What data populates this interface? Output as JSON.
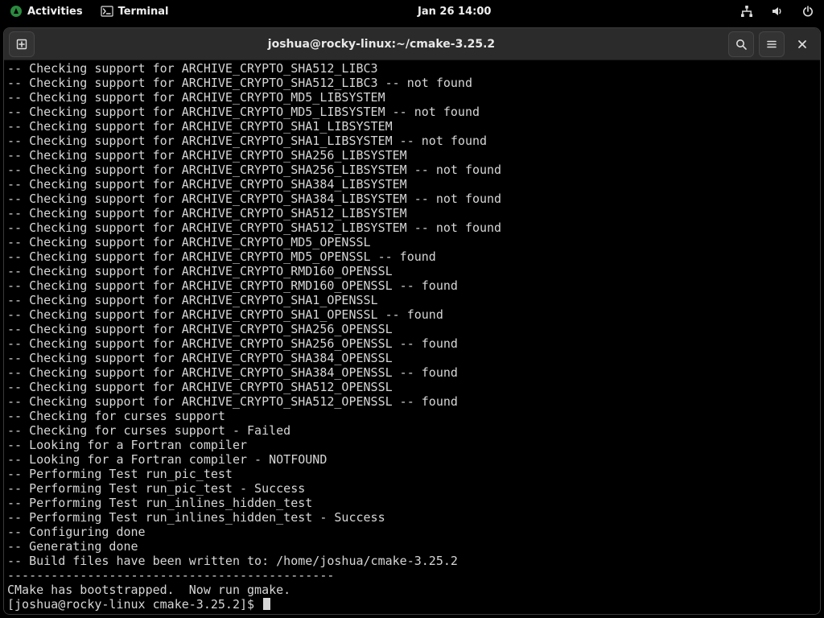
{
  "topbar": {
    "activities_label": "Activities",
    "app_label": "Terminal",
    "clock": "Jan 26  14:00"
  },
  "window": {
    "title": "joshua@rocky-linux:~/cmake-3.25.2"
  },
  "terminal": {
    "lines": [
      "-- Checking support for ARCHIVE_CRYPTO_SHA512_LIBC3",
      "-- Checking support for ARCHIVE_CRYPTO_SHA512_LIBC3 -- not found",
      "-- Checking support for ARCHIVE_CRYPTO_MD5_LIBSYSTEM",
      "-- Checking support for ARCHIVE_CRYPTO_MD5_LIBSYSTEM -- not found",
      "-- Checking support for ARCHIVE_CRYPTO_SHA1_LIBSYSTEM",
      "-- Checking support for ARCHIVE_CRYPTO_SHA1_LIBSYSTEM -- not found",
      "-- Checking support for ARCHIVE_CRYPTO_SHA256_LIBSYSTEM",
      "-- Checking support for ARCHIVE_CRYPTO_SHA256_LIBSYSTEM -- not found",
      "-- Checking support for ARCHIVE_CRYPTO_SHA384_LIBSYSTEM",
      "-- Checking support for ARCHIVE_CRYPTO_SHA384_LIBSYSTEM -- not found",
      "-- Checking support for ARCHIVE_CRYPTO_SHA512_LIBSYSTEM",
      "-- Checking support for ARCHIVE_CRYPTO_SHA512_LIBSYSTEM -- not found",
      "-- Checking support for ARCHIVE_CRYPTO_MD5_OPENSSL",
      "-- Checking support for ARCHIVE_CRYPTO_MD5_OPENSSL -- found",
      "-- Checking support for ARCHIVE_CRYPTO_RMD160_OPENSSL",
      "-- Checking support for ARCHIVE_CRYPTO_RMD160_OPENSSL -- found",
      "-- Checking support for ARCHIVE_CRYPTO_SHA1_OPENSSL",
      "-- Checking support for ARCHIVE_CRYPTO_SHA1_OPENSSL -- found",
      "-- Checking support for ARCHIVE_CRYPTO_SHA256_OPENSSL",
      "-- Checking support for ARCHIVE_CRYPTO_SHA256_OPENSSL -- found",
      "-- Checking support for ARCHIVE_CRYPTO_SHA384_OPENSSL",
      "-- Checking support for ARCHIVE_CRYPTO_SHA384_OPENSSL -- found",
      "-- Checking support for ARCHIVE_CRYPTO_SHA512_OPENSSL",
      "-- Checking support for ARCHIVE_CRYPTO_SHA512_OPENSSL -- found",
      "-- Checking for curses support",
      "-- Checking for curses support - Failed",
      "-- Looking for a Fortran compiler",
      "-- Looking for a Fortran compiler - NOTFOUND",
      "-- Performing Test run_pic_test",
      "-- Performing Test run_pic_test - Success",
      "-- Performing Test run_inlines_hidden_test",
      "-- Performing Test run_inlines_hidden_test - Success",
      "-- Configuring done",
      "-- Generating done",
      "-- Build files have been written to: /home/joshua/cmake-3.25.2",
      "---------------------------------------------",
      "CMake has bootstrapped.  Now run gmake."
    ],
    "prompt": "[joshua@rocky-linux cmake-3.25.2]$ "
  }
}
